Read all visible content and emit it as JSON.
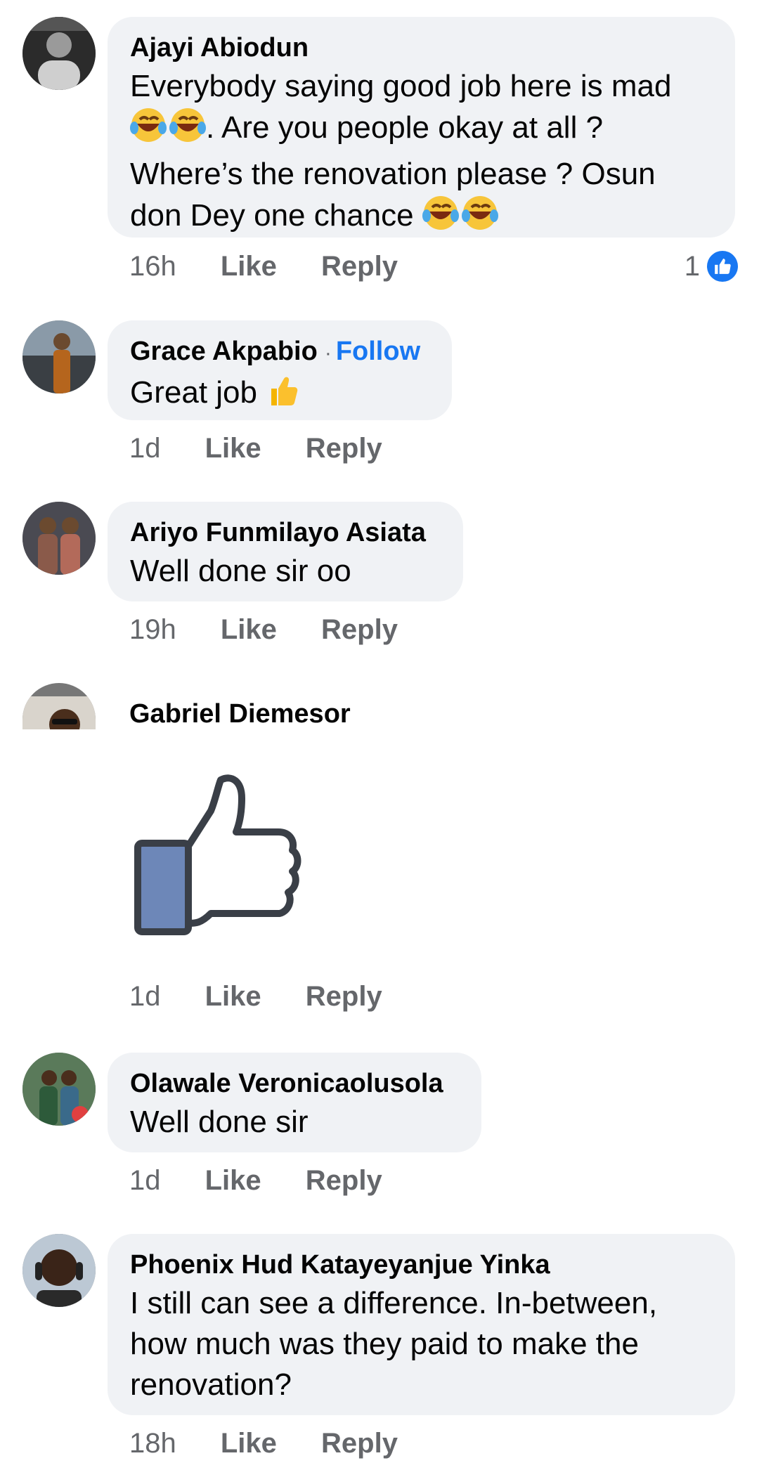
{
  "comments": [
    {
      "author": "Ajayi Abiodun",
      "lines": [
        "Everybody saying good job here is mad",
        ". Are you people okay at all ?",
        "Where’s the renovation please ? Osun",
        "don Dey one chance"
      ],
      "time": "16h",
      "like": "Like",
      "reply": "Reply",
      "reaction_count": "1"
    },
    {
      "author": "Grace Akpabio",
      "follow_sep": "·",
      "follow": "Follow",
      "text": "Great job",
      "time": "1d",
      "like": "Like",
      "reply": "Reply"
    },
    {
      "author": "Ariyo Funmilayo Asiata",
      "text": "Well done sir oo",
      "time": "19h",
      "like": "Like",
      "reply": "Reply"
    },
    {
      "author": "Gabriel Diemesor",
      "sticker": "thumbs-up-sticker",
      "time": "1d",
      "like": "Like",
      "reply": "Reply"
    },
    {
      "author": "Olawale Veronicaolusola",
      "text": "Well done sir",
      "time": "1d",
      "like": "Like",
      "reply": "Reply"
    },
    {
      "author": "Phoenix Hud Katayeyanjue Yinka",
      "lines": [
        "I still can see a difference. In-between,",
        "how much was they paid to make the",
        "renovation?"
      ],
      "time": "18h",
      "like": "Like",
      "reply": "Reply"
    }
  ],
  "colors": {
    "bubble": "#f0f2f5",
    "meta": "#65676b",
    "link": "#1877f2",
    "sticker_fill": "#6d87b8"
  }
}
